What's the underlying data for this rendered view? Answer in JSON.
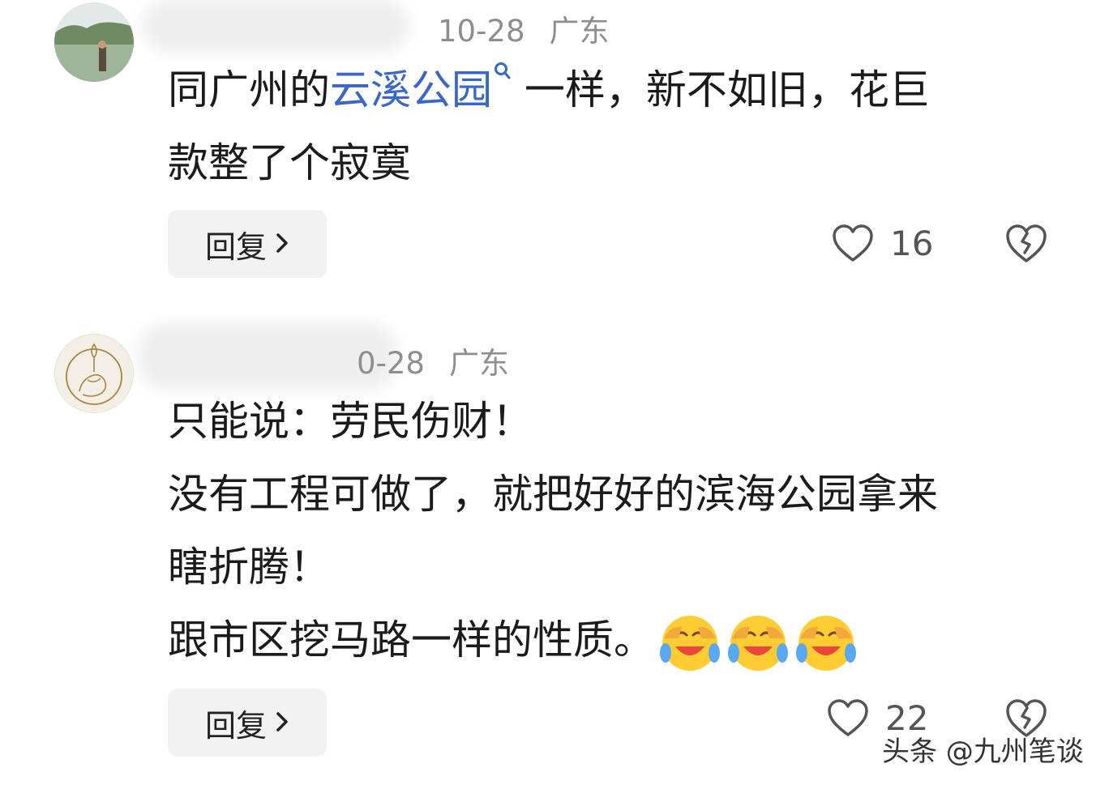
{
  "comments": [
    {
      "date": "10-28",
      "location": "广东",
      "text_line1_prefix": "同广州的",
      "text_link": "云溪公园",
      "text_line1_suffix": " 一样，新不如旧，花巨",
      "text_line2": "款整了个寂寞",
      "reply_label": "回复",
      "likes": "16"
    },
    {
      "date": "0-28",
      "location": "广东",
      "lines": [
        "只能说：劳民伤财！",
        "没有工程可做了，就把好好的滨海公园拿来",
        "瞎折腾！",
        "跟市区挖马路一样的性质。"
      ],
      "emoji_count": 3,
      "reply_label": "回复",
      "likes": "22"
    }
  ],
  "watermark": "头条 @九州笔谈",
  "icons": {
    "like": "heart-outline-icon",
    "dislike": "broken-heart-icon",
    "reply_arrow": "chevron-right-icon",
    "link_search": "search-icon",
    "emoji": "laughing-crying-emoji"
  },
  "colors": {
    "link": "#3867c8",
    "meta": "#8e8e8e",
    "button_bg": "#f2f2f2"
  }
}
